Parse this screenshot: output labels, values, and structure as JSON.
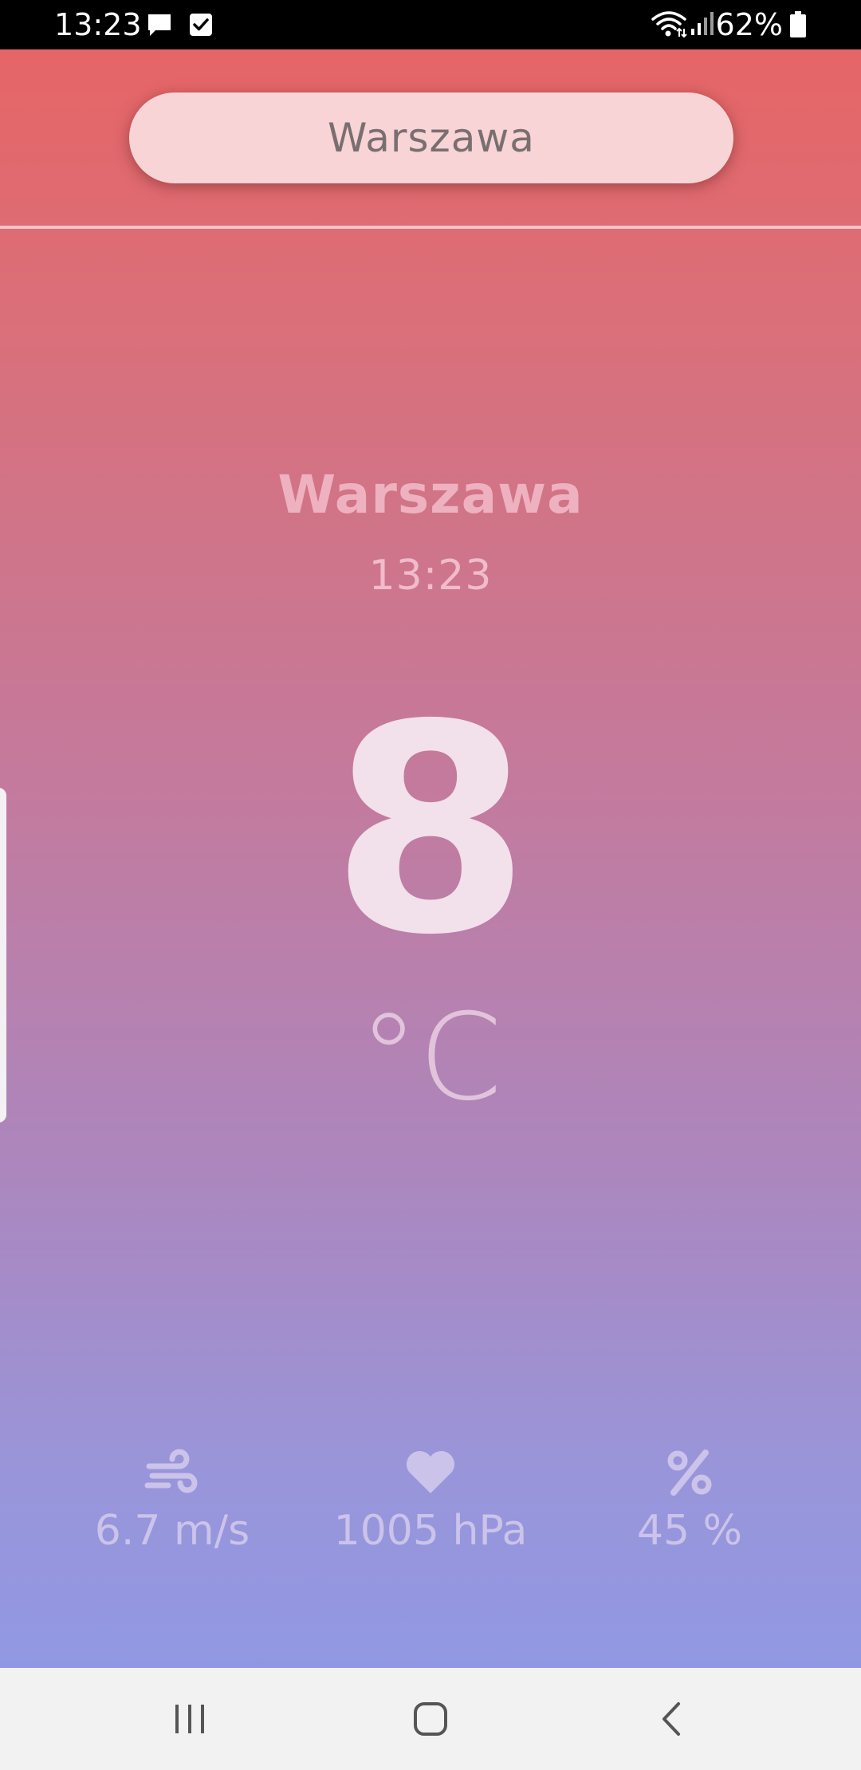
{
  "status_bar": {
    "time": "13:23",
    "battery": "62%",
    "icons": [
      "message-icon",
      "check-box-icon",
      "wifi-icon",
      "signal-icon",
      "battery-icon"
    ]
  },
  "search": {
    "value": "Warszawa",
    "placeholder": ""
  },
  "weather": {
    "city": "Warszawa",
    "time": "13:23",
    "temperature": "8",
    "unit": "°C"
  },
  "stats": {
    "wind": {
      "icon": "wind-icon",
      "value": "6.7 m/s"
    },
    "pressure": {
      "icon": "heart-icon",
      "value": "1005 hPa"
    },
    "humidity": {
      "icon": "percent-icon",
      "value": "45 %"
    }
  },
  "nav": {
    "icons": [
      "recents-icon",
      "home-icon",
      "back-icon"
    ]
  },
  "colors": {
    "gradient_top": "#e66566",
    "gradient_bottom": "#9198e3",
    "search_bg": "#f8d4d6"
  }
}
